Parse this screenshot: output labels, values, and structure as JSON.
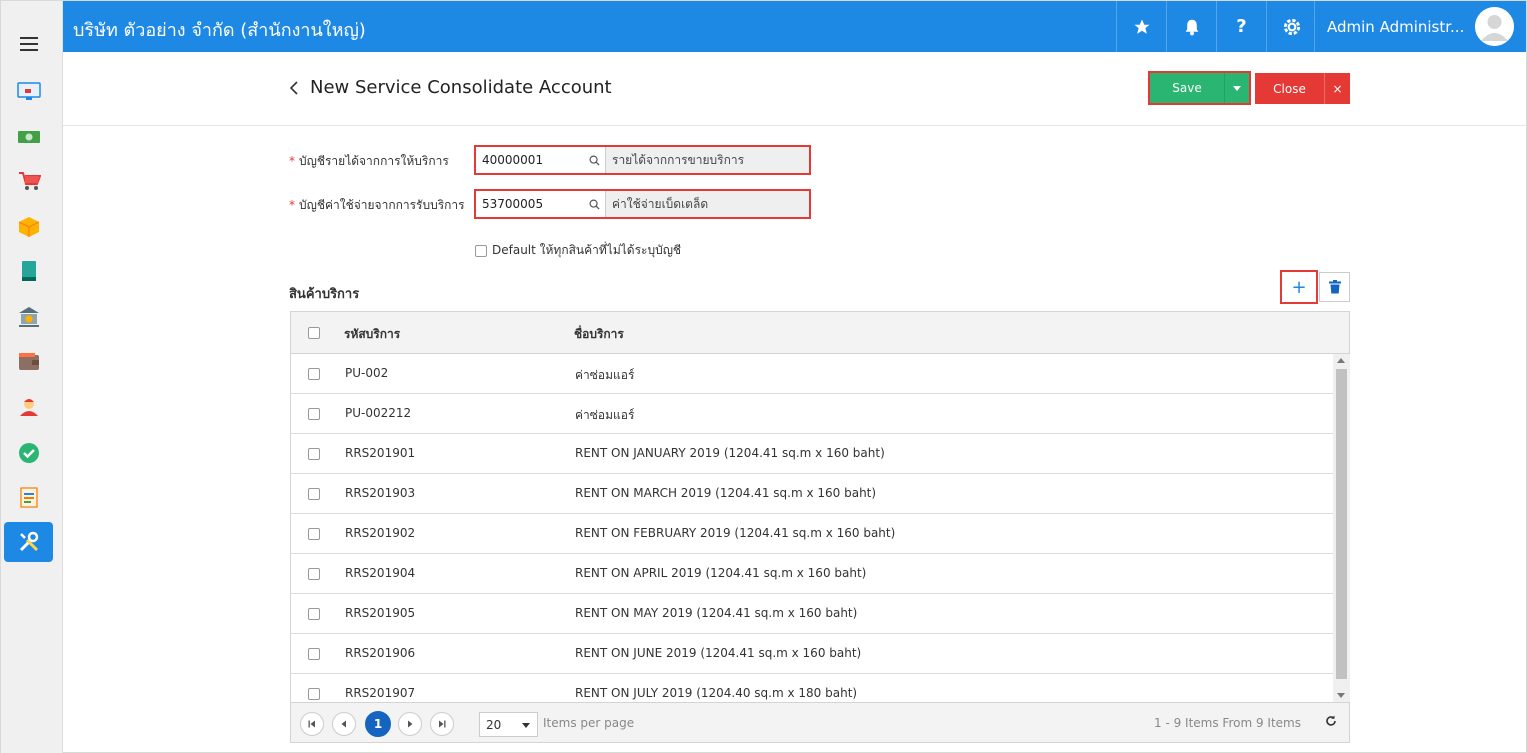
{
  "header": {
    "company": "บริษัท ตัวอย่าง จำกัด (สำนักงานใหญ่)",
    "user_name": "Admin Administr...",
    "icons": [
      "star-icon",
      "bell-icon",
      "help-icon",
      "settings-icon"
    ]
  },
  "sidebar": {
    "menu_icon": "hamburger-icon",
    "items": [
      "dashboard-icon",
      "money-icon",
      "cart-icon",
      "box-icon",
      "book-icon",
      "bank-icon",
      "wallet-icon",
      "contacts-icon",
      "approve-icon",
      "report-icon",
      "tools-icon"
    ],
    "active": "tools-icon"
  },
  "page": {
    "title": "New Service Consolidate Account",
    "save_label": "Save",
    "close_label": "Close",
    "close_x": "×"
  },
  "form": {
    "revenue": {
      "label": "บัญชีรายได้จากการให้บริการ",
      "code": "40000001",
      "desc": "รายได้จากการขายบริการ"
    },
    "expense": {
      "label": "บัญชีค่าใช้จ่ายจากการรับบริการ",
      "code": "53700005",
      "desc": "ค่าใช้จ่ายเบ็ดเตล็ด"
    },
    "default_label": "Default ให้ทุกสินค้าที่ไม่ได้ระบุบัญชี"
  },
  "services": {
    "title": "สินค้าบริการ",
    "add_symbol": "+",
    "columns": [
      "รหัสบริการ",
      "ชื่อบริการ"
    ],
    "rows": [
      {
        "code": "PU-002",
        "name": "ค่าซ่อมแอร์"
      },
      {
        "code": "PU-002212",
        "name": "ค่าซ่อมแอร์"
      },
      {
        "code": "RRS201901",
        "name": "RENT ON JANUARY 2019 (1204.41 sq.m x 160 baht)"
      },
      {
        "code": "RRS201903",
        "name": "RENT ON MARCH 2019 (1204.41 sq.m x 160 baht)"
      },
      {
        "code": "RRS201902",
        "name": "RENT ON FEBRUARY 2019 (1204.41 sq.m x 160 baht)"
      },
      {
        "code": "RRS201904",
        "name": "RENT ON APRIL 2019 (1204.41 sq.m x 160 baht)"
      },
      {
        "code": "RRS201905",
        "name": "RENT ON MAY 2019 (1204.41 sq.m x 160 baht)"
      },
      {
        "code": "RRS201906",
        "name": "RENT ON JUNE 2019 (1204.41 sq.m x 160 baht)"
      },
      {
        "code": "RRS201907",
        "name": "RENT ON JULY 2019 (1204.40 sq.m x 180 baht)"
      }
    ]
  },
  "pager": {
    "current_page": "1",
    "page_size": "20",
    "page_size_label": "Items per page",
    "info": "1 - 9 Items From 9 Items"
  },
  "colors": {
    "primary": "#1e88e5",
    "save": "#2bb573",
    "close": "#e53935",
    "highlight": "#e53935"
  }
}
